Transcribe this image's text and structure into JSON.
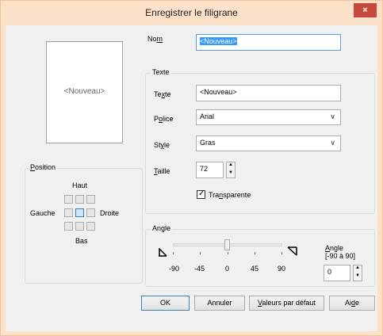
{
  "window": {
    "title": "Enregistrer le filigrane",
    "close_glyph": "×"
  },
  "preview": {
    "text": "<Nouveau>"
  },
  "name": {
    "label_pre": "No",
    "label_ul": "m",
    "value": "<Nouveau>"
  },
  "text_group": {
    "title": "Texte",
    "text": {
      "label_pre": "Te",
      "label_ul": "x",
      "label_post": "te",
      "value": "<Nouveau>"
    },
    "font": {
      "label_pre": "P",
      "label_ul": "o",
      "label_post": "lice",
      "value": "Arial"
    },
    "style": {
      "label_pre": "St",
      "label_ul": "y",
      "label_post": "le",
      "value": "Gras"
    },
    "size": {
      "label_pre": "",
      "label_ul": "T",
      "label_post": "aille",
      "value": "72"
    },
    "transparent": {
      "label_pre": "Tra",
      "label_ul": "n",
      "label_post": "sparente",
      "checked": true
    }
  },
  "position_group": {
    "title_ul": "P",
    "title_post": "osition",
    "top": "Haut",
    "left": "Gauche",
    "right": "Droite",
    "bottom": "Bas",
    "selected": "center"
  },
  "angle_group": {
    "title": "Angle",
    "ticks": [
      "-90",
      "-45",
      "0",
      "45",
      "90"
    ],
    "value_label_ul": "A",
    "value_label_post": "ngle",
    "range": "[-90 à 90]",
    "value": "0",
    "slider_value": 0
  },
  "buttons": {
    "ok": "OK",
    "cancel": "Annuler",
    "defaults_ul": "V",
    "defaults_post": "aleurs par défaut",
    "help_pre": "Ai",
    "help_ul": "d",
    "help_post": "e"
  }
}
